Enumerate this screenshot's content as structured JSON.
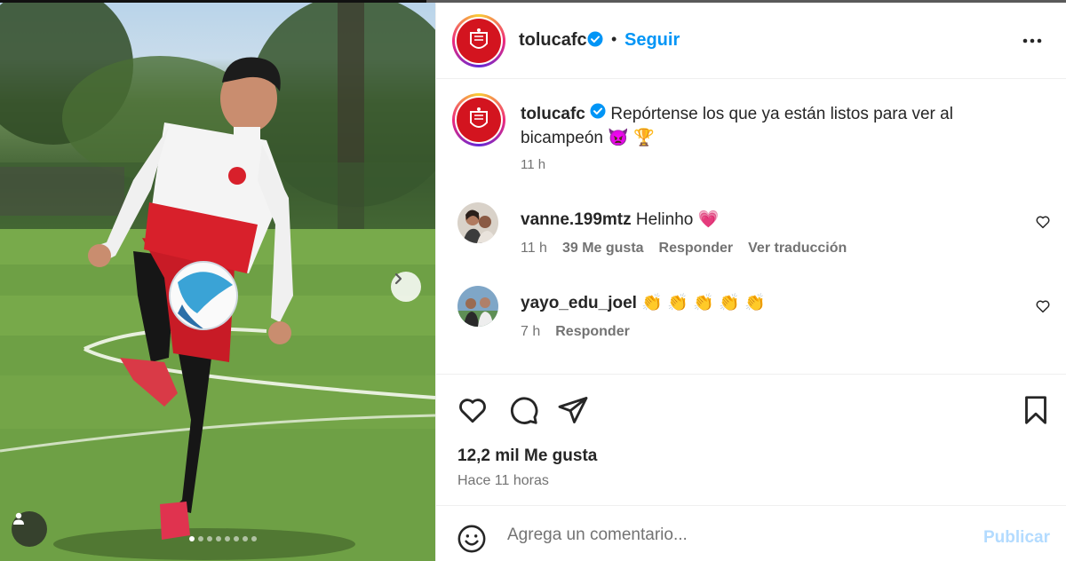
{
  "post": {
    "username": "tolucafc",
    "follow_label": "Seguir",
    "separator": "•",
    "caption_text": "Repórtense los que ya están listos para ver al bicampeón 👿 🏆",
    "caption_time": "11 h",
    "photo_alt": "Jugador del Toluca dominando un balón en el campo de entrenamiento",
    "carousel": {
      "slides": 8,
      "current": 1
    }
  },
  "comments": [
    {
      "username": "vanne.199mtz",
      "text": "Helinho 💗",
      "time": "11 h",
      "likes": "39 Me gusta",
      "reply": "Responder",
      "translate": "Ver traducción"
    },
    {
      "username": "yayo_edu_joel",
      "text": "👏 👏 👏 👏 👏",
      "time": "7 h",
      "reply": "Responder"
    }
  ],
  "actions": {
    "likes_count": "12,2 mil Me gusta",
    "posted_ago": "Hace 11 horas"
  },
  "add_comment": {
    "placeholder": "Agrega un comentario...",
    "post_label": "Publicar"
  },
  "colors": {
    "accent": "#0095f6",
    "post_disabled": "#b3dbff",
    "brand_red": "#d3141f",
    "muted": "#737373"
  },
  "icons": [
    "verified-badge-icon",
    "more-options-icon",
    "heart-icon",
    "comment-icon",
    "share-icon",
    "bookmark-icon",
    "emoji-icon",
    "chevron-right-icon",
    "user-tag-icon"
  ]
}
